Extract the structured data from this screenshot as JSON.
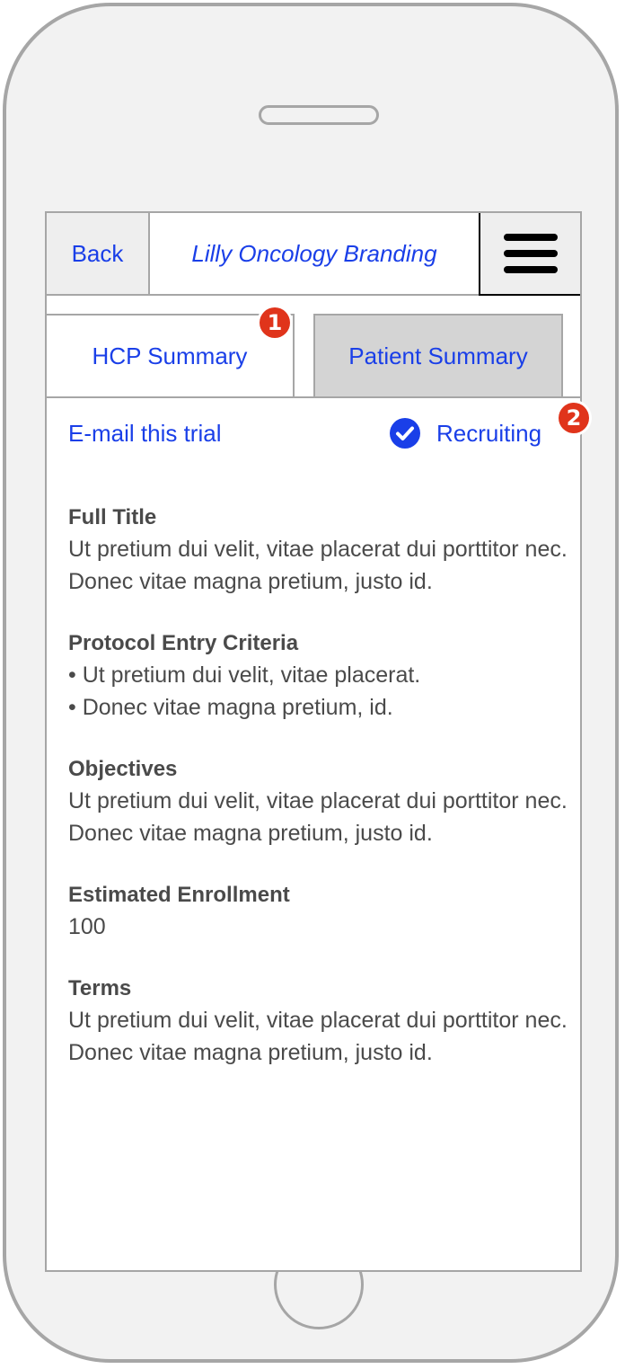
{
  "header": {
    "back_label": "Back",
    "brand_title": "Lilly Oncology Branding",
    "menu_icon": "hamburger-menu-icon"
  },
  "tabs": [
    {
      "label": "HCP Summary",
      "selected": true
    },
    {
      "label": "Patient Summary",
      "selected": false
    }
  ],
  "annotations": {
    "badge_1": "1",
    "badge_2": "2"
  },
  "actions": {
    "email_label": "E-mail this trial",
    "status_label": "Recruiting",
    "status_icon": "check-circle-icon"
  },
  "sections": {
    "full_title": {
      "title": "Full Title",
      "body": "Ut pretium dui velit, vitae placerat dui porttitor nec. Donec vitae magna pretium, justo id."
    },
    "protocol": {
      "title": "Protocol Entry Criteria",
      "items": [
        "• Ut pretium dui velit, vitae placerat.",
        "• Donec vitae magna pretium, id."
      ]
    },
    "objectives": {
      "title": "Objectives",
      "body": "Ut pretium dui velit, vitae placerat dui porttitor nec. Donec vitae magna pretium, justo id."
    },
    "enrollment": {
      "title": "Estimated Enrollment",
      "body": "100"
    },
    "terms": {
      "title": "Terms",
      "body": "Ut pretium dui velit, vitae placerat dui porttitor nec. Donec vitae magna pretium, justo id."
    }
  },
  "colors": {
    "link_blue": "#1a3fe8",
    "badge_red": "#e0341b",
    "device_gray": "#a6a6a6"
  }
}
